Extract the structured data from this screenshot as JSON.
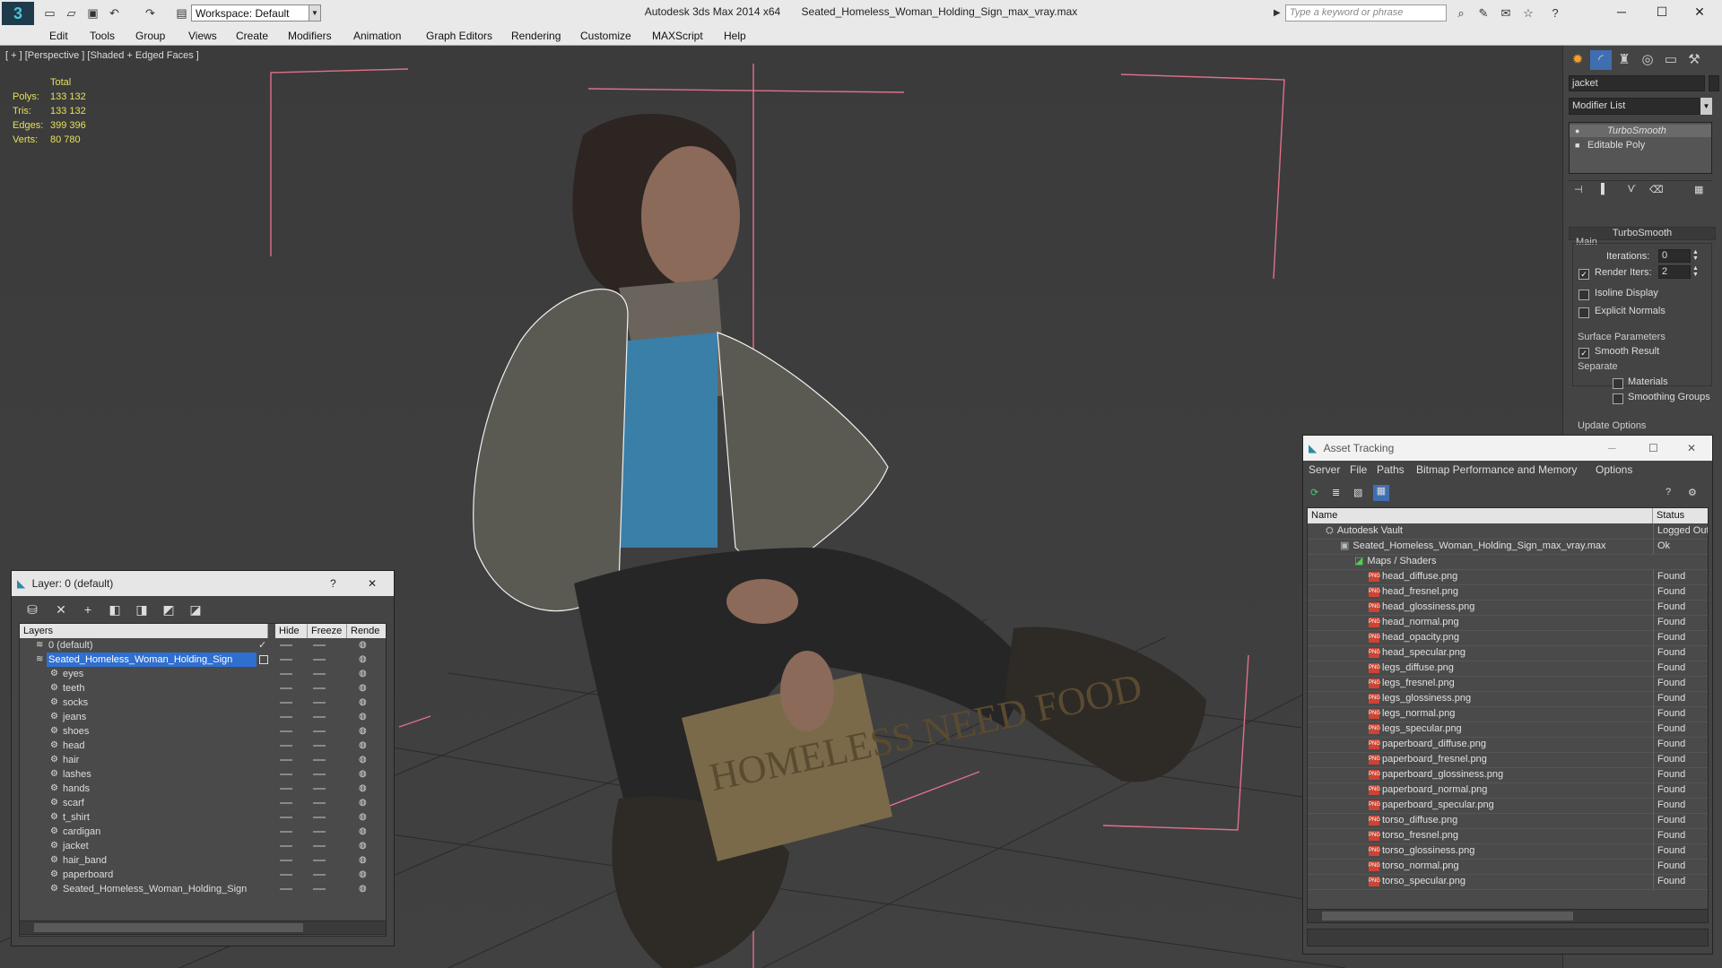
{
  "titlebar": {
    "workspace": "Workspace: Default",
    "app_name": "Autodesk 3ds Max  2014 x64",
    "file_name": "Seated_Homeless_Woman_Holding_Sign_max_vray.max",
    "search_placeholder": "Type a keyword or phrase"
  },
  "menu": [
    "Edit",
    "Tools",
    "Group",
    "Views",
    "Create",
    "Modifiers",
    "Animation",
    "Graph Editors",
    "Rendering",
    "Customize",
    "MAXScript",
    "Help"
  ],
  "viewport": {
    "label": "[ + ] [Perspective ] [Shaded + Edged Faces ]",
    "stats": {
      "header": "Total",
      "polys_label": "Polys:",
      "polys": "133 132",
      "tris_label": "Tris:",
      "tris": "133 132",
      "edges_label": "Edges:",
      "edges": "399 396",
      "verts_label": "Verts:",
      "verts": "80 780"
    }
  },
  "command_panel": {
    "object_name": "jacket",
    "modifier_list": "Modifier List",
    "stack": [
      "TurboSmooth",
      "Editable Poly"
    ],
    "rollout_title": "TurboSmooth",
    "main_group": "Main",
    "iterations_label": "Iterations:",
    "iterations": "0",
    "render_iters_label": "Render Iters:",
    "render_iters": "2",
    "isoline_label": "Isoline Display",
    "explicit_normals_label": "Explicit Normals",
    "surface_group": "Surface Parameters",
    "smooth_result_label": "Smooth Result",
    "separate_label": "Separate",
    "materials_label": "Materials",
    "smoothing_groups_label": "Smoothing Groups",
    "update_group": "Update Options"
  },
  "layer_window": {
    "title": "Layer: 0 (default)",
    "help": "?",
    "columns": {
      "layers": "Layers",
      "hide": "Hide",
      "freeze": "Freeze",
      "render": "Rende"
    },
    "rows": [
      {
        "name": "0 (default)",
        "indent": 1
      },
      {
        "name": "Seated_Homeless_Woman_Holding_Sign",
        "indent": 1,
        "selected": true
      },
      {
        "name": "eyes",
        "indent": 2
      },
      {
        "name": "teeth",
        "indent": 2
      },
      {
        "name": "socks",
        "indent": 2
      },
      {
        "name": "jeans",
        "indent": 2
      },
      {
        "name": "shoes",
        "indent": 2
      },
      {
        "name": "head",
        "indent": 2
      },
      {
        "name": "hair",
        "indent": 2
      },
      {
        "name": "lashes",
        "indent": 2
      },
      {
        "name": "hands",
        "indent": 2
      },
      {
        "name": "scarf",
        "indent": 2
      },
      {
        "name": "t_shirt",
        "indent": 2
      },
      {
        "name": "cardigan",
        "indent": 2
      },
      {
        "name": "jacket",
        "indent": 2
      },
      {
        "name": "hair_band",
        "indent": 2
      },
      {
        "name": "paperboard",
        "indent": 2
      },
      {
        "name": "Seated_Homeless_Woman_Holding_Sign",
        "indent": 2
      }
    ]
  },
  "asset_window": {
    "title": "Asset Tracking",
    "menu": [
      "Server",
      "File",
      "Paths",
      "Bitmap Performance and Memory",
      "Options"
    ],
    "columns": {
      "name": "Name",
      "status": "Status"
    },
    "rows": [
      {
        "name": "Autodesk Vault",
        "status": "Logged Out",
        "level": 0,
        "icon": "vault"
      },
      {
        "name": "Seated_Homeless_Woman_Holding_Sign_max_vray.max",
        "status": "Ok",
        "level": 1,
        "icon": "max"
      },
      {
        "name": "Maps / Shaders",
        "status": "",
        "level": 2,
        "icon": "maps"
      },
      {
        "name": "head_diffuse.png",
        "status": "Found",
        "level": 3,
        "icon": "png"
      },
      {
        "name": "head_fresnel.png",
        "status": "Found",
        "level": 3,
        "icon": "png"
      },
      {
        "name": "head_glossiness.png",
        "status": "Found",
        "level": 3,
        "icon": "png"
      },
      {
        "name": "head_normal.png",
        "status": "Found",
        "level": 3,
        "icon": "png"
      },
      {
        "name": "head_opacity.png",
        "status": "Found",
        "level": 3,
        "icon": "png"
      },
      {
        "name": "head_specular.png",
        "status": "Found",
        "level": 3,
        "icon": "png"
      },
      {
        "name": "legs_diffuse.png",
        "status": "Found",
        "level": 3,
        "icon": "png"
      },
      {
        "name": "legs_fresnel.png",
        "status": "Found",
        "level": 3,
        "icon": "png"
      },
      {
        "name": "legs_glossiness.png",
        "status": "Found",
        "level": 3,
        "icon": "png"
      },
      {
        "name": "legs_normal.png",
        "status": "Found",
        "level": 3,
        "icon": "png"
      },
      {
        "name": "legs_specular.png",
        "status": "Found",
        "level": 3,
        "icon": "png"
      },
      {
        "name": "paperboard_diffuse.png",
        "status": "Found",
        "level": 3,
        "icon": "png"
      },
      {
        "name": "paperboard_fresnel.png",
        "status": "Found",
        "level": 3,
        "icon": "png"
      },
      {
        "name": "paperboard_glossiness.png",
        "status": "Found",
        "level": 3,
        "icon": "png"
      },
      {
        "name": "paperboard_normal.png",
        "status": "Found",
        "level": 3,
        "icon": "png"
      },
      {
        "name": "paperboard_specular.png",
        "status": "Found",
        "level": 3,
        "icon": "png"
      },
      {
        "name": "torso_diffuse.png",
        "status": "Found",
        "level": 3,
        "icon": "png"
      },
      {
        "name": "torso_fresnel.png",
        "status": "Found",
        "level": 3,
        "icon": "png"
      },
      {
        "name": "torso_glossiness.png",
        "status": "Found",
        "level": 3,
        "icon": "png"
      },
      {
        "name": "torso_normal.png",
        "status": "Found",
        "level": 3,
        "icon": "png"
      },
      {
        "name": "torso_specular.png",
        "status": "Found",
        "level": 3,
        "icon": "png"
      }
    ]
  },
  "sign_text": "HOMELESS NEED FOOD",
  "colors": {
    "selection": "#2f6fd0",
    "stats": "#e5e05a",
    "bbox": "#e0708a",
    "app_accent": "#4fc2d6"
  }
}
